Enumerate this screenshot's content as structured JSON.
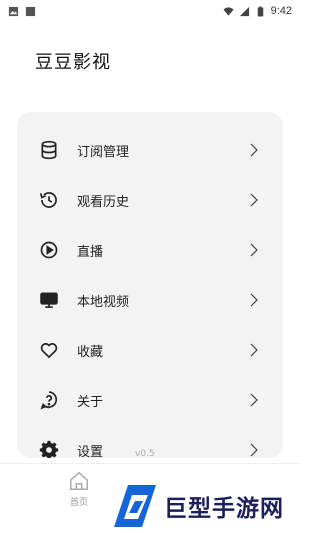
{
  "status_bar": {
    "time": "9:42"
  },
  "app": {
    "title": "豆豆影视"
  },
  "menu": {
    "items": [
      {
        "label": "订阅管理",
        "icon": "database-icon"
      },
      {
        "label": "观看历史",
        "icon": "history-icon"
      },
      {
        "label": "直播",
        "icon": "play-circle-icon"
      },
      {
        "label": "本地视频",
        "icon": "monitor-icon"
      },
      {
        "label": "收藏",
        "icon": "heart-icon"
      },
      {
        "label": "关于",
        "icon": "question-icon"
      },
      {
        "label": "设置",
        "icon": "gear-icon"
      }
    ]
  },
  "footer": {
    "version": "v0.5"
  },
  "bottom_nav": {
    "home_label": "首页"
  },
  "watermark": {
    "text": "巨型手游网"
  },
  "colors": {
    "card_bg": "#f3f3f3",
    "watermark_blue": "#1565d8",
    "watermark_text": "#1b1f5a"
  }
}
